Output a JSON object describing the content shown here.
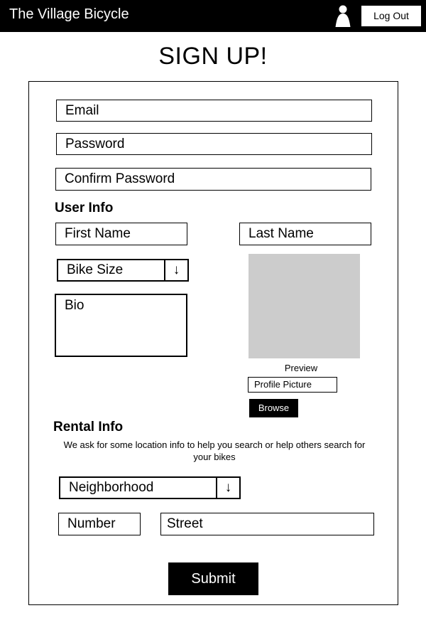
{
  "header": {
    "brand": "The Village Bicycle",
    "user_icon": "person-icon",
    "logout_label": "Log Out"
  },
  "page_title": "SIGN UP!",
  "account": {
    "email_placeholder": "Email",
    "password_placeholder": "Password",
    "confirm_password_placeholder": "Confirm Password"
  },
  "user_info": {
    "heading": "User Info",
    "first_name_placeholder": "First Name",
    "last_name_placeholder": "Last Name",
    "bike_size_label": "Bike Size",
    "bike_size_arrow": "↓",
    "bio_placeholder": "Bio",
    "preview_label": "Preview",
    "profile_picture_placeholder": "Profile Picture",
    "browse_label": "Browse"
  },
  "rental_info": {
    "heading": "Rental Info",
    "note": "We ask for some location info to help you search or help others search for your bikes",
    "neighborhood_label": "Neighborhood",
    "neighborhood_arrow": "↓",
    "number_placeholder": "Number",
    "street_placeholder": "Street"
  },
  "submit_label": "Submit",
  "colors": {
    "bar": "#000000",
    "preview_fill": "#cccccc",
    "background": "#ffffff"
  }
}
